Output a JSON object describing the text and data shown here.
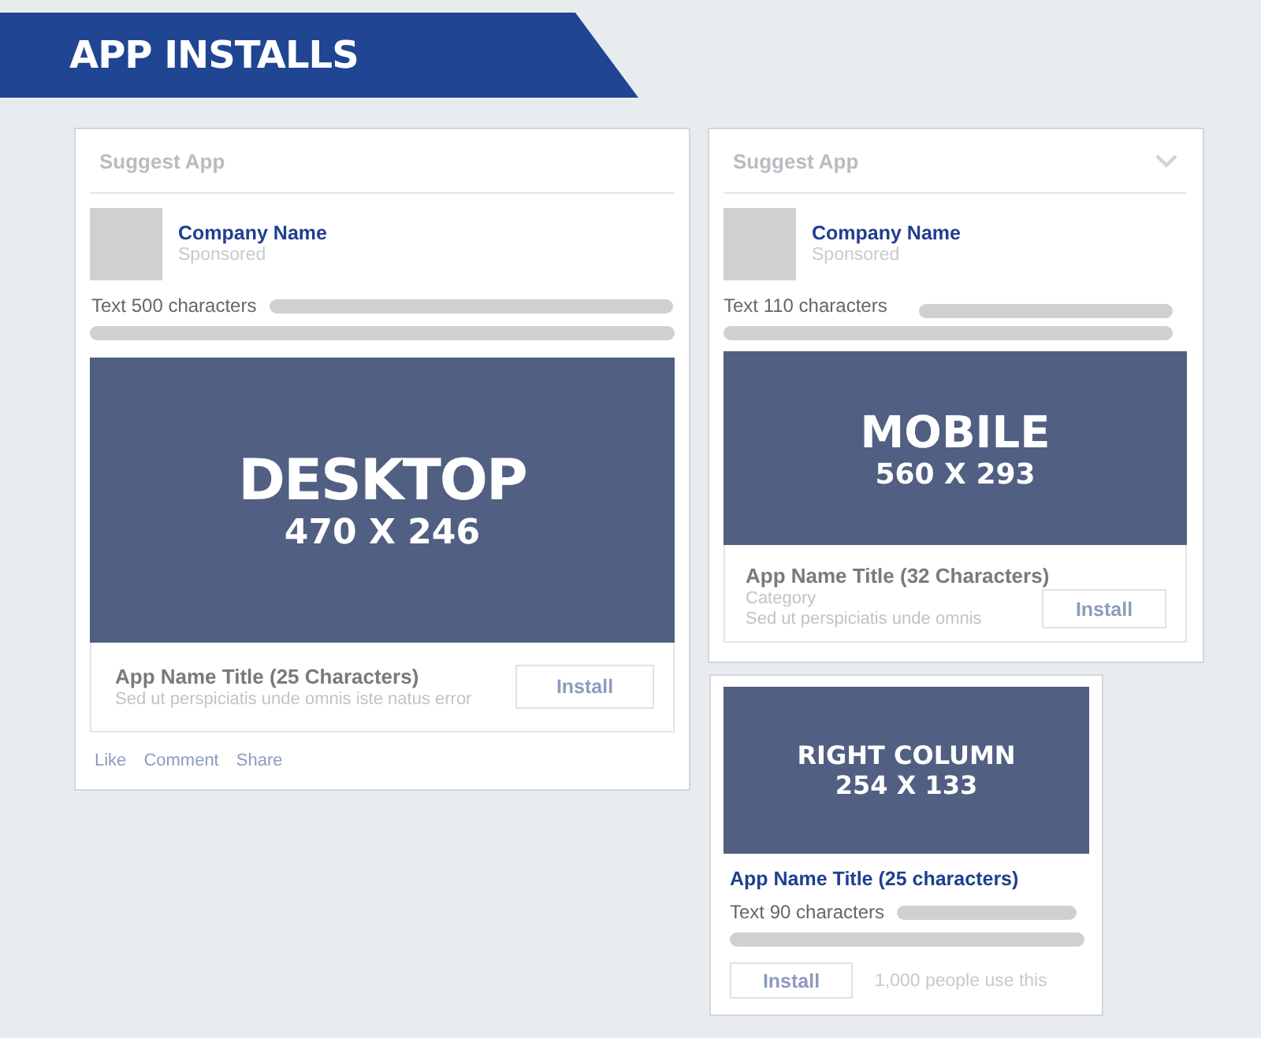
{
  "banner": {
    "title": "APP INSTALLS"
  },
  "ads": [
    {
      "kind": "desktop",
      "header": "Suggest App",
      "company": "Company Name",
      "sponsored": "Sponsored",
      "text": "Text 500 characters",
      "media": {
        "label": "DESKTOP",
        "size": "470 X 246"
      },
      "app_title": "App Name Title (25 Characters)",
      "description": "Sed ut perspiciatis unde omnis iste natus error",
      "button": "Install",
      "actions": [
        "Like",
        "Comment",
        "Share"
      ]
    },
    {
      "kind": "mobile",
      "header": "Suggest App",
      "company": "Company Name",
      "sponsored": "Sponsored",
      "text": "Text 110 characters",
      "media": {
        "label": "MOBILE",
        "size": "560 X 293"
      },
      "app_title": "App Name Title (32 Characters)",
      "category": "Category",
      "description": "Sed ut perspiciatis unde omnis",
      "button": "Install"
    },
    {
      "kind": "right_column",
      "media": {
        "label": "RIGHT COLUMN",
        "size": "254 X 133"
      },
      "app_title": "App Name Title (25 characters)",
      "text": "Text 90 characters",
      "button": "Install",
      "social": "1,000 people use this"
    }
  ]
}
